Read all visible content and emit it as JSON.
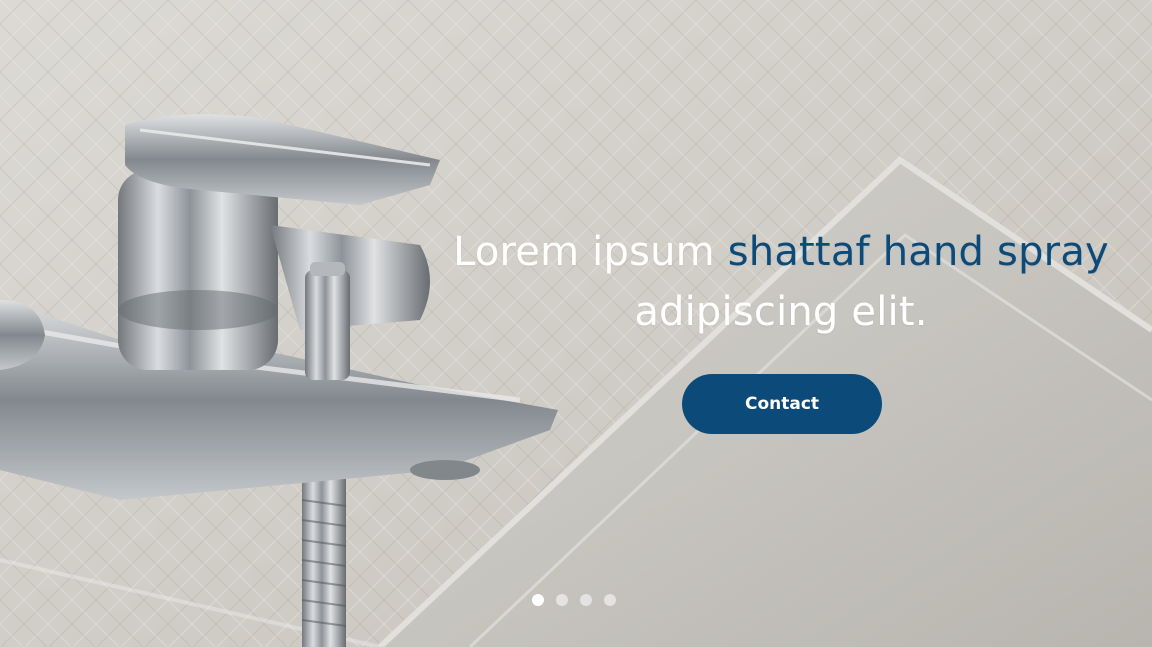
{
  "hero": {
    "headline_part1": "Lorem ipsum ",
    "headline_accent": "shattaf hand spray",
    "headline_part2": "adipiscing elit.",
    "accent_color": "#0c4a7a",
    "background_image": "chrome-faucet-bathtub-photo"
  },
  "cta": {
    "label": "Contact",
    "color": "#0c4a7a"
  },
  "slider": {
    "total_slides": 4,
    "active_slide": 1
  }
}
